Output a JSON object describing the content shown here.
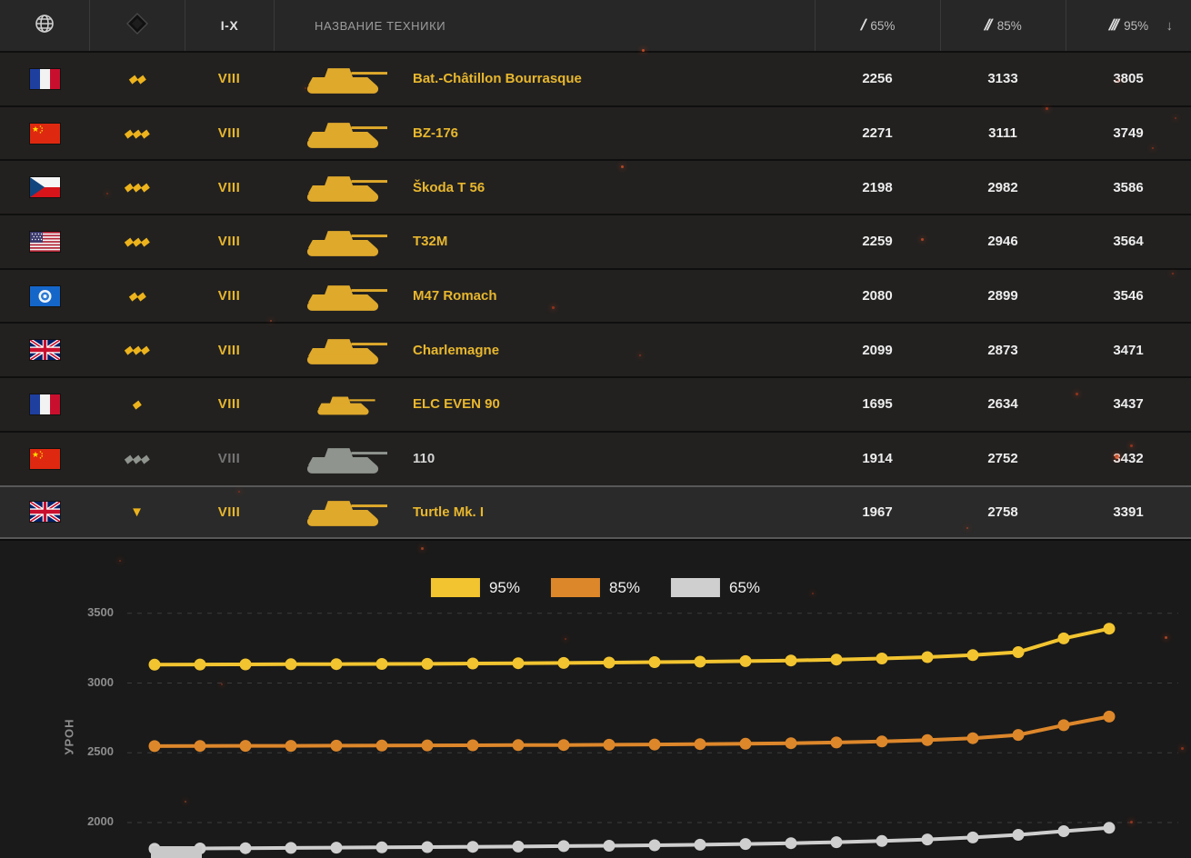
{
  "header": {
    "tier_filter": "I-X",
    "name_column_label": "НАЗВАНИЕ ТЕХНИКИ",
    "percent_columns": [
      {
        "slashes": "/",
        "label": "65%"
      },
      {
        "slashes": "//",
        "label": "85%"
      },
      {
        "slashes": "///",
        "label": "95%"
      }
    ],
    "sort_arrow": "↓",
    "icons": {
      "nation_filter": "globe-icon",
      "class_filter": "class-filter-icon",
      "sort": "arrow-down-icon"
    }
  },
  "table": {
    "rows": [
      {
        "nation": "france",
        "vehicle_class": "medium",
        "class_glyph": "◆◆",
        "tier": "VIII",
        "name": "Bat.-Châtillon Bourrasque",
        "premium": true,
        "v65": "2256",
        "v85": "3133",
        "v95": "3805"
      },
      {
        "nation": "china",
        "vehicle_class": "heavy",
        "class_glyph": "◆◆◆",
        "tier": "VIII",
        "name": "BZ-176",
        "premium": true,
        "v65": "2271",
        "v85": "3111",
        "v95": "3749"
      },
      {
        "nation": "czech",
        "vehicle_class": "heavy",
        "class_glyph": "◆◆◆",
        "tier": "VIII",
        "name": "Škoda T 56",
        "premium": true,
        "v65": "2198",
        "v85": "2982",
        "v95": "3586"
      },
      {
        "nation": "usa",
        "vehicle_class": "heavy",
        "class_glyph": "◆◆◆",
        "tier": "VIII",
        "name": "T32M",
        "premium": true,
        "v65": "2259",
        "v85": "2946",
        "v95": "3564"
      },
      {
        "nation": "special",
        "vehicle_class": "medium",
        "class_glyph": "◆◆",
        "tier": "VIII",
        "name": "M47 Romach",
        "premium": true,
        "v65": "2080",
        "v85": "2899",
        "v95": "3546"
      },
      {
        "nation": "uk",
        "vehicle_class": "heavy",
        "class_glyph": "◆◆◆",
        "tier": "VIII",
        "name": "Charlemagne",
        "premium": true,
        "v65": "2099",
        "v85": "2873",
        "v95": "3471"
      },
      {
        "nation": "france",
        "vehicle_class": "light",
        "class_glyph": "◆",
        "tier": "VIII",
        "name": "ELC EVEN 90",
        "premium": true,
        "v65": "1695",
        "v85": "2634",
        "v95": "3437"
      },
      {
        "nation": "china",
        "vehicle_class": "heavy",
        "class_glyph": "◆◆◆",
        "tier": "VIII",
        "name": "110",
        "premium": false,
        "v65": "1914",
        "v85": "2752",
        "v95": "3432"
      },
      {
        "nation": "uk",
        "vehicle_class": "td",
        "class_glyph": "▼",
        "tier": "VIII",
        "name": "Turtle Mk. I",
        "premium": true,
        "highlighted": true,
        "v65": "1967",
        "v85": "2758",
        "v95": "3391"
      }
    ]
  },
  "chart_data": {
    "type": "line",
    "title": "",
    "xlabel": "",
    "ylabel": "УРОН",
    "yticks": [
      3500,
      3000,
      2500,
      2000
    ],
    "ylim": [
      1750,
      3600
    ],
    "grid": "dashed-horizontal",
    "legend_position": "top-center",
    "series": [
      {
        "name": "95%",
        "color": "#f2c430",
        "values": [
          3132,
          3133,
          3134,
          3135,
          3136,
          3137,
          3138,
          3140,
          3142,
          3144,
          3147,
          3150,
          3153,
          3157,
          3162,
          3168,
          3176,
          3186,
          3200,
          3222,
          3320,
          3390
        ]
      },
      {
        "name": "85%",
        "color": "#dd872b",
        "values": [
          2548,
          2549,
          2550,
          2550,
          2551,
          2552,
          2553,
          2554,
          2555,
          2556,
          2558,
          2560,
          2562,
          2565,
          2569,
          2574,
          2581,
          2591,
          2605,
          2628,
          2698,
          2760
        ]
      },
      {
        "name": "65%",
        "color": "#cfcfcf",
        "values": [
          1812,
          1814,
          1816,
          1818,
          1820,
          1822,
          1824,
          1826,
          1828,
          1831,
          1834,
          1837,
          1841,
          1846,
          1852,
          1859,
          1868,
          1879,
          1893,
          1912,
          1938,
          1962
        ]
      }
    ]
  }
}
